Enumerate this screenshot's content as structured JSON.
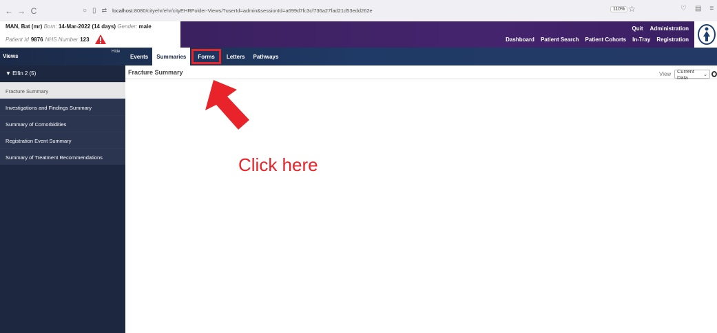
{
  "browser": {
    "back": "←",
    "forward": "→",
    "reload": "C",
    "url_host": "localhost",
    "url_rest": ":8080/cityehr/ehr/cityEHRFolder-Views/?userId=admin&sessionId=a699d7fc3cf736a27fad21d53edd262e",
    "zoom": "110%"
  },
  "patient": {
    "name": "MAN, Bat (mr)",
    "born_label": "Born:",
    "born_value": "14-Mar-2022 (14 days)",
    "gender_label": "Gender:",
    "gender_value": "male",
    "id_label": "Patient Id",
    "id_value": "9876",
    "nhs_label": "NHS Number",
    "nhs_value": "123"
  },
  "top_menu": {
    "row1": [
      "Quit",
      "Administration"
    ],
    "row2": [
      "Dashboard",
      "Patient Search",
      "Patient Cohorts",
      "In-Tray",
      "Registration"
    ]
  },
  "tab_bar": {
    "views_label": "Views",
    "hide_label": "Hide",
    "tabs": [
      "Events",
      "Summaries",
      "Forms",
      "Letters",
      "Pathways"
    ]
  },
  "sidebar": {
    "header": "▼ Elfin 2 (5)",
    "items": [
      "Fracture Summary",
      "Investigations and Findings Summary",
      "Summary of Comorbidities",
      "Registration Event Summary",
      "Summary of Treatment Recommendations"
    ]
  },
  "content": {
    "title": "Fracture Summary",
    "view_label": "View",
    "view_value": "Current Data"
  },
  "annotation": {
    "text": "Click here",
    "color": "#e8232a"
  },
  "colors": {
    "menu_purple": "#45246e",
    "navy": "#1d2840",
    "highlight_red": "#e8232a"
  }
}
